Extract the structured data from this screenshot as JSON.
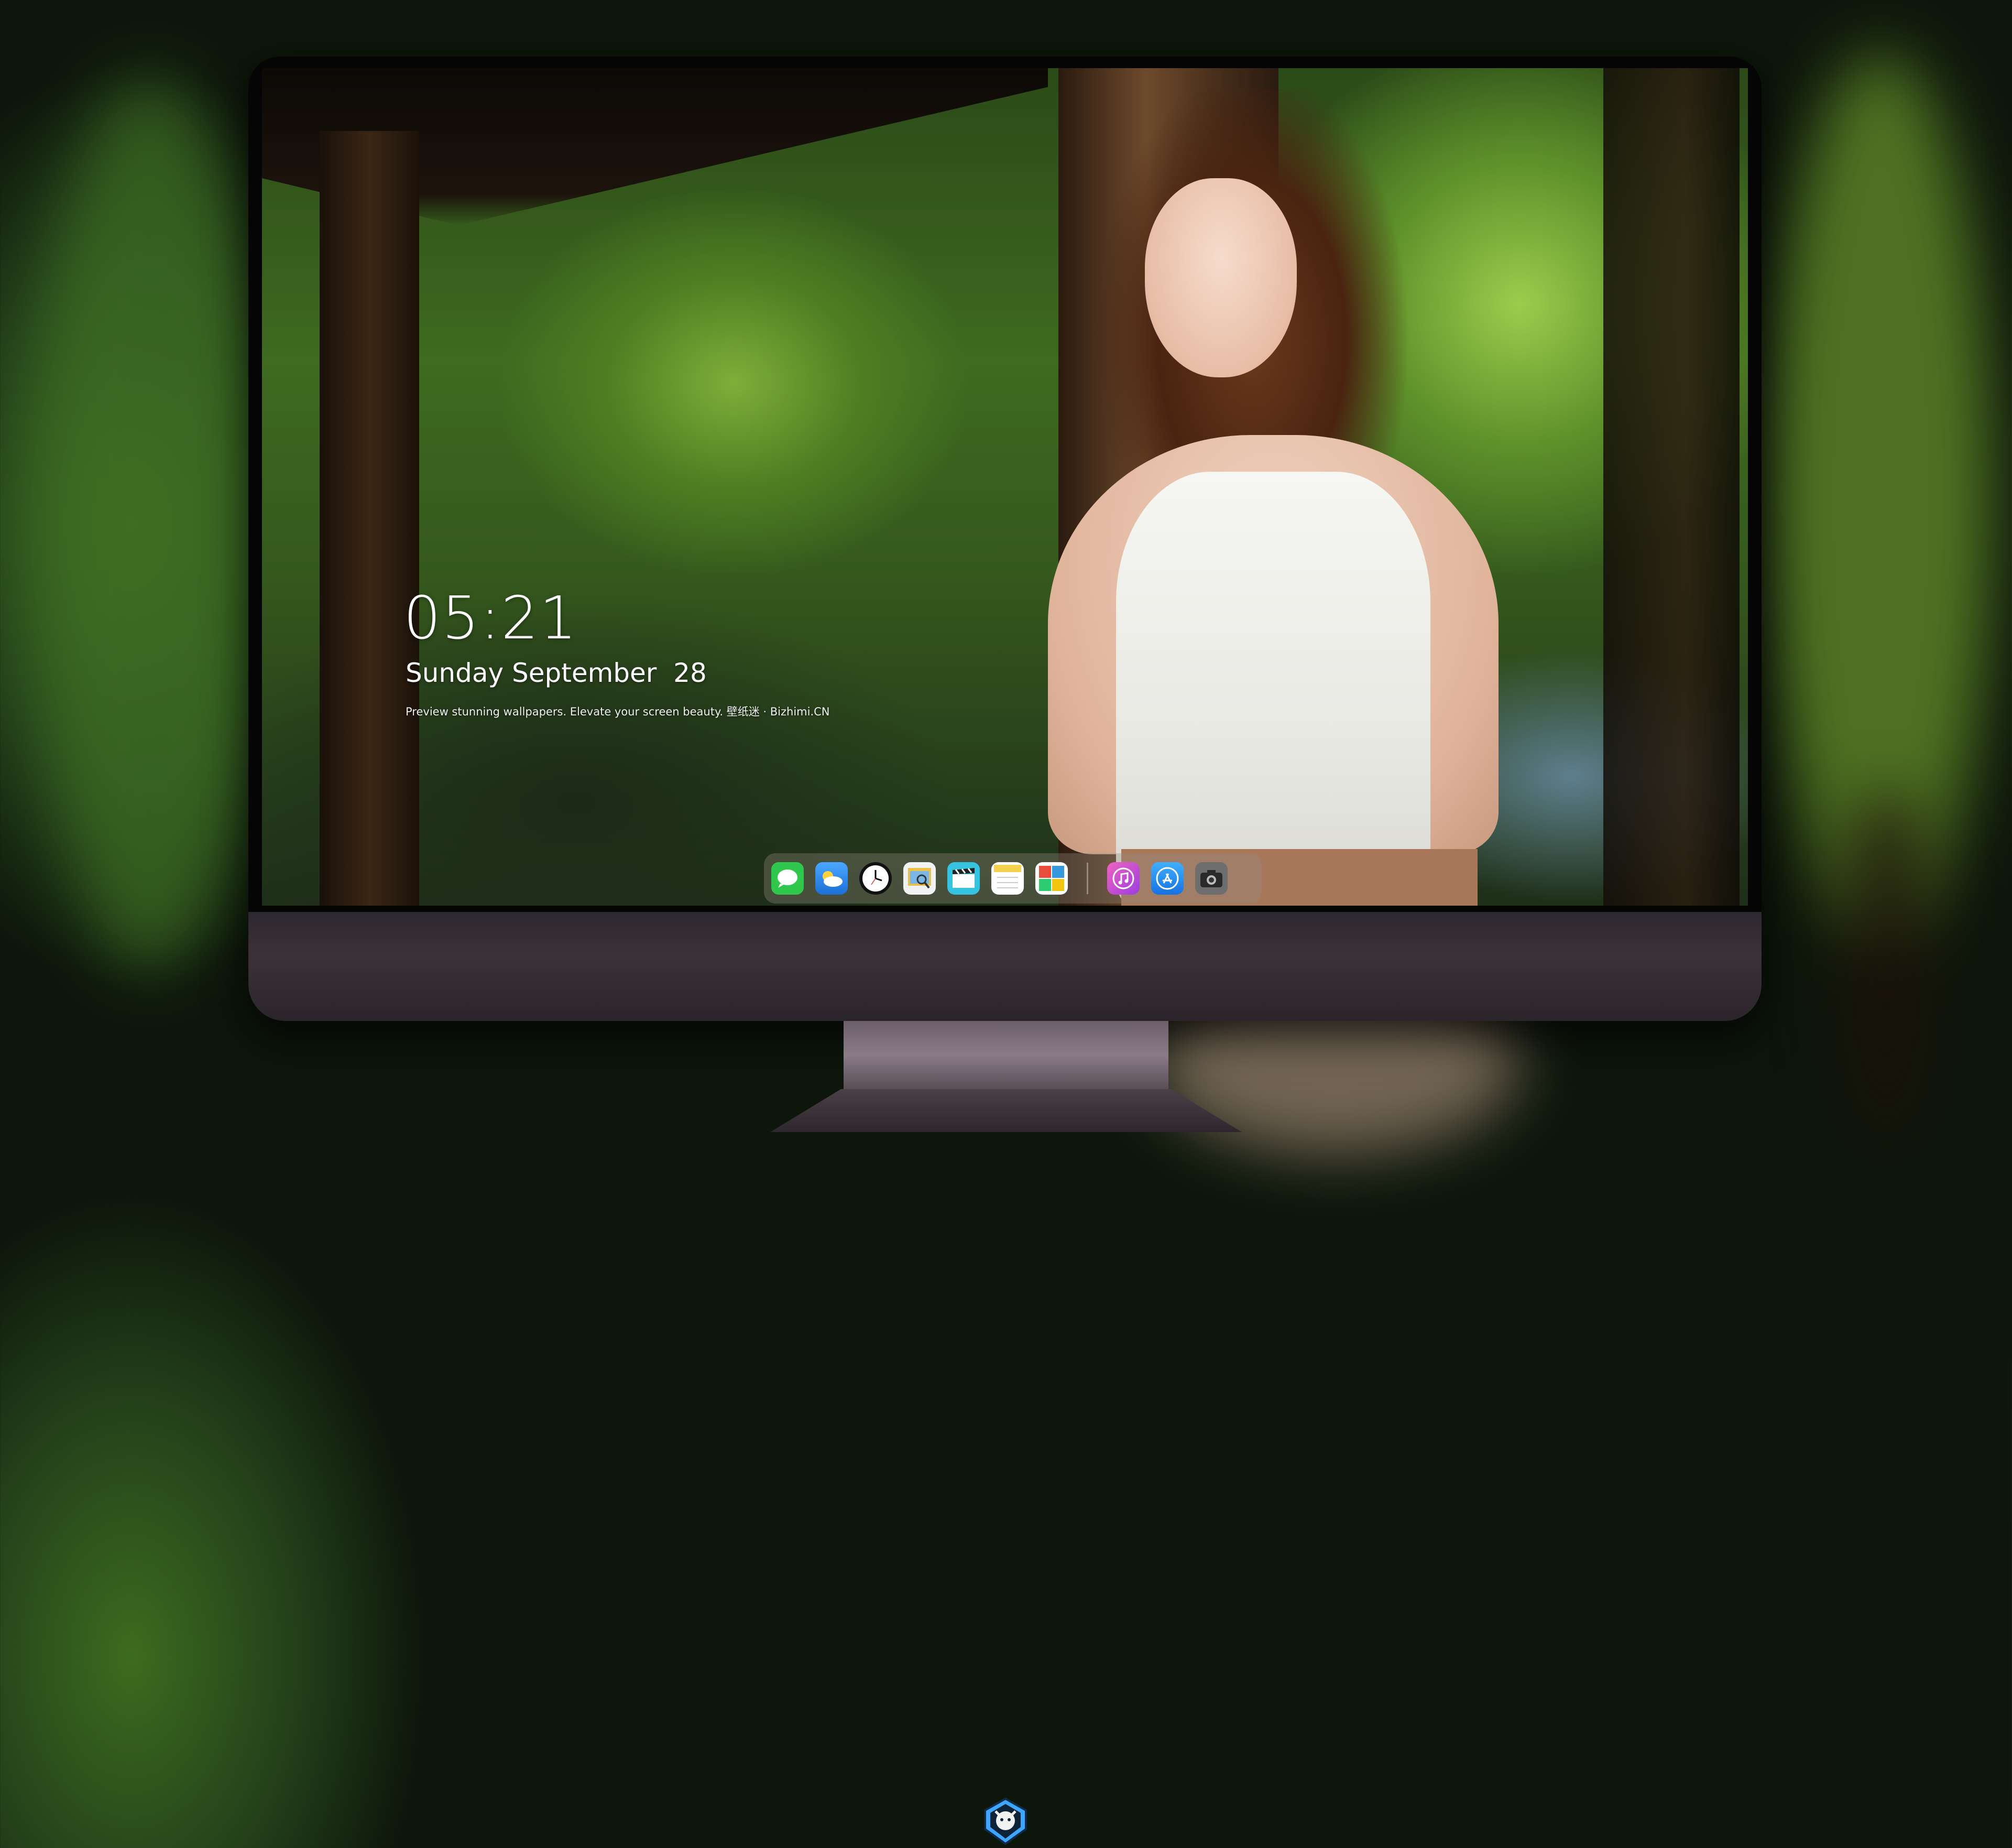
{
  "lockscreen": {
    "time": "05:21",
    "date": "Sunday September  28",
    "tagline": "Preview stunning wallpapers. Elevate your screen beauty. 壁纸迷 · Bizhimi.CN"
  },
  "dock": {
    "icons": [
      {
        "name": "messages-icon",
        "color": "#2fc84c"
      },
      {
        "name": "weather-icon",
        "color": "#2a8fe8"
      },
      {
        "name": "clock-icon",
        "color": "#1a1a1a"
      },
      {
        "name": "preview-icon",
        "color": "#e8c24a"
      },
      {
        "name": "clips-icon",
        "color": "#3ec6e0"
      },
      {
        "name": "notes-icon",
        "color": "#f4d250"
      },
      {
        "name": "photo-booth-icon",
        "color": "#e74c3c"
      },
      {
        "name": "music-icon",
        "color": "#c341d6"
      },
      {
        "name": "app-store-icon",
        "color": "#1e88e5"
      },
      {
        "name": "camera-icon",
        "color": "#555555"
      }
    ]
  },
  "brand": {
    "logo_icon": "shield-mascot-icon",
    "colors": {
      "accent": "#3ea6ff"
    }
  }
}
